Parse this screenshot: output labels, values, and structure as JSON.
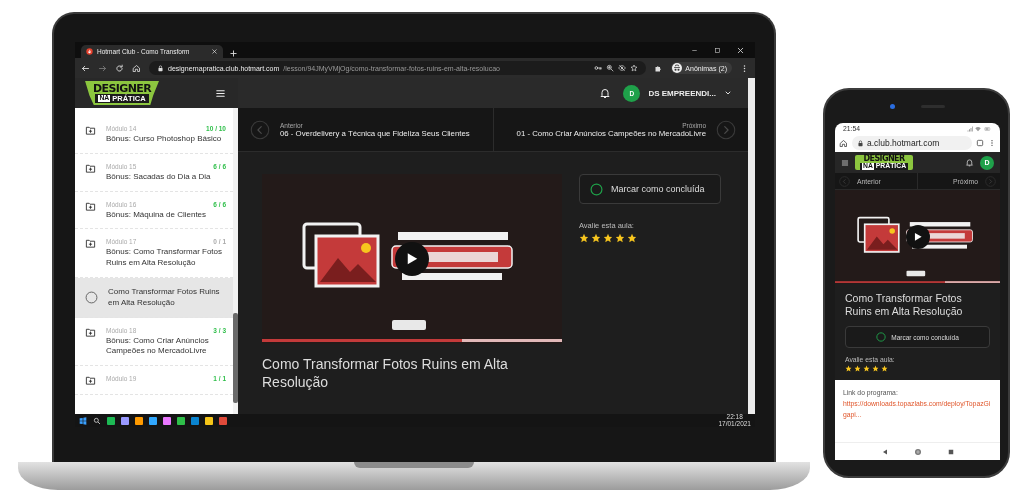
{
  "laptop": {
    "browser": {
      "tab_title": "Hotmart Club - Como Transform",
      "url_host": "designernapratica.club.hotmart.com",
      "url_path": "/lesson/94JMyVMjOg/como-transformar-fotos-ruins-em-alta-resolucao",
      "profile": "Anônimas (2)"
    },
    "logo": {
      "top": "DESIGNER",
      "badge": "NA",
      "bottom": "PRÁTICA"
    },
    "header": {
      "avatar": "D",
      "user": "DS EMPREENDI..."
    },
    "sidebar": {
      "items": [
        {
          "kind": "module",
          "label": "Módulo 14",
          "title": "Bônus: Curso Photoshop Básico",
          "progress": "10 / 10",
          "complete": true,
          "selected": false
        },
        {
          "kind": "module",
          "label": "Módulo 15",
          "title": "Bônus: Sacadas do Dia a Dia",
          "progress": "6 / 6",
          "complete": true,
          "selected": false
        },
        {
          "kind": "module",
          "label": "Módulo 16",
          "title": "Bônus: Máquina de Clientes",
          "progress": "6 / 6",
          "complete": true,
          "selected": false
        },
        {
          "kind": "module",
          "label": "Módulo 17",
          "title": "Bônus: Como Transformar Fotos Ruins em Alta Resolução",
          "progress": "0 / 1",
          "complete": false,
          "selected": false
        },
        {
          "kind": "lesson",
          "title": "Como Transformar Fotos Ruins em Alta Resolução",
          "complete": false,
          "selected": true
        },
        {
          "kind": "module",
          "label": "Módulo 18",
          "title": "Bônus: Como Criar Anúncios Campeões no MercadoLivre",
          "progress": "3 / 3",
          "complete": true,
          "selected": false
        },
        {
          "kind": "module",
          "label": "Módulo 19",
          "progress": "1 / 1",
          "complete": true,
          "selected": false
        }
      ]
    },
    "nav": {
      "previous": {
        "label": "Anterior",
        "title": "06 - Overdelivery a Técnica que Fideliza Seus Clientes"
      },
      "next": {
        "label": "Próximo",
        "title": "01 - Como Criar Anúncios Campeões no MercadoLivre"
      }
    },
    "lesson_title": "Como Transformar Fotos Ruins em Alta Resolução",
    "complete_button": {
      "label": "Marcar como concluída",
      "checked": false
    },
    "rating": {
      "label": "Avalie esta aula:",
      "stars": 5
    },
    "taskbar": {
      "time": "22:18",
      "date": "17/01/2021"
    }
  },
  "phone": {
    "status_time": "21:54",
    "url": "a.club.hotmart.com",
    "logo": {
      "top": "DESIGNER",
      "badge": "NA",
      "bottom": "PRÁTICA"
    },
    "avatar": "D",
    "nav": {
      "previous": {
        "label": "Anterior"
      },
      "next": {
        "label": "Próximo"
      }
    },
    "lesson_title": "Como Transformar Fotos Ruins em Alta Resolução",
    "complete_button": {
      "label": "Marcar como concluída",
      "checked": false
    },
    "rating": {
      "label": "Avalie esta aula:",
      "stars": 5
    },
    "description": {
      "text": "Link do programa:",
      "link": "https://downloads.topazlabs.com/deploy/TopazGigapi..."
    }
  }
}
